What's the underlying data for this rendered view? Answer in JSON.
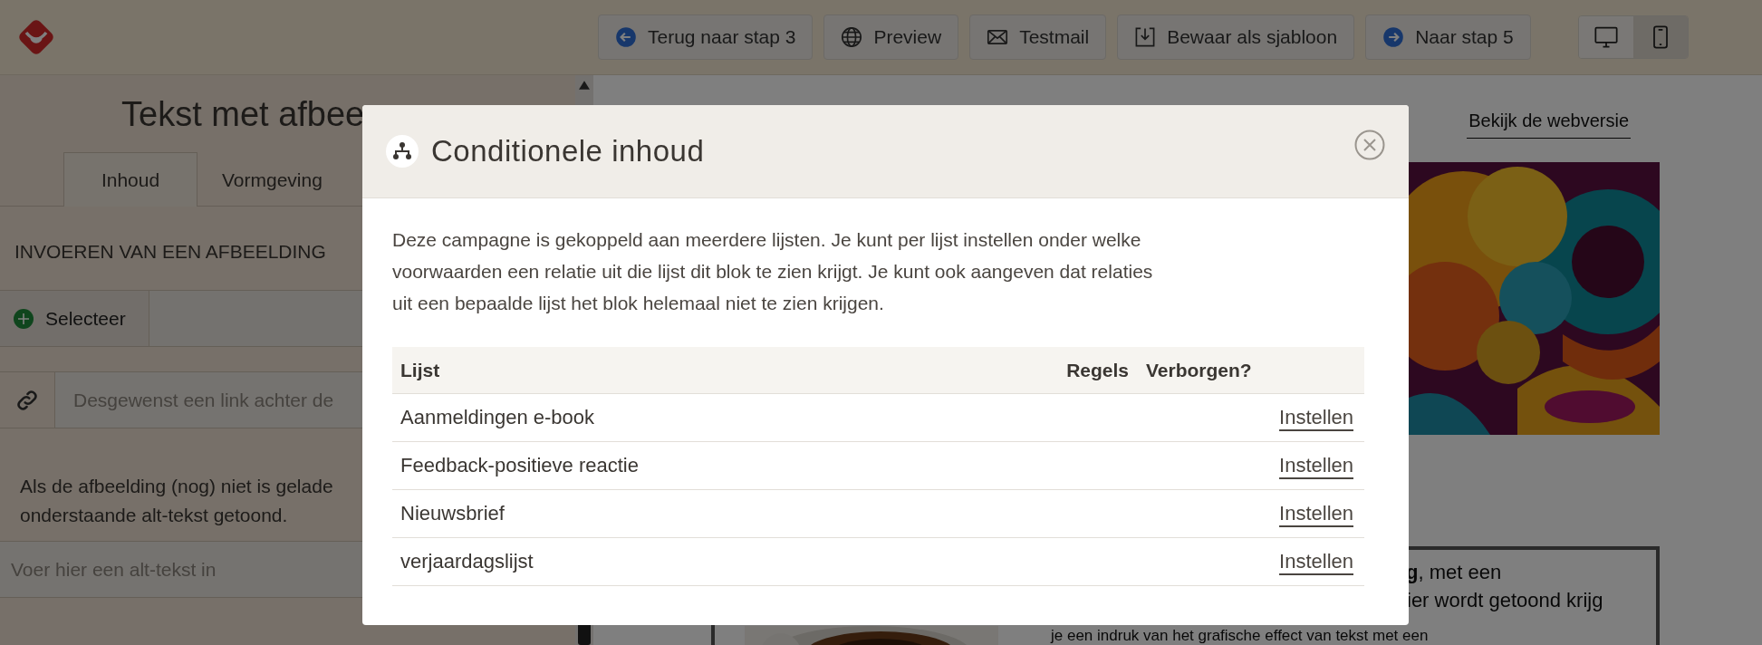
{
  "toolbar": {
    "buttons": [
      {
        "label": "Terug naar stap 3"
      },
      {
        "label": "Preview"
      },
      {
        "label": "Testmail"
      },
      {
        "label": "Bewaar als sjabloon"
      },
      {
        "label": "Naar stap 5"
      }
    ],
    "view_toggle": [
      {
        "selected": true
      },
      {
        "selected": false
      }
    ]
  },
  "editor": {
    "title": "Tekst met afbee",
    "tabs": [
      {
        "label": "Inhoud",
        "selected": true
      },
      {
        "label": "Vormgeving",
        "selected": false
      }
    ],
    "section_label": "INVOEREN VAN EEN AFBEELDING",
    "select_button": "Selecteer",
    "link_field": {
      "placeholder": "Desgewenst een link achter de"
    },
    "info_lines": [
      "Als de afbeelding (nog) niet is gelade",
      "onderstaande alt-tekst getoond."
    ],
    "alt_field": {
      "placeholder": "Voer hier een alt-tekst in"
    }
  },
  "preview": {
    "web_link": "Bekijk de webversie",
    "text_lines": [
      "**g**, met een",
      "ier wordt getoond krijg",
      "je een indruk van het grafische effect van tekst met een"
    ]
  },
  "modal": {
    "title": "Conditionele inhoud",
    "intro": "Deze campagne is gekoppeld aan meerdere lijsten. Je kunt per lijst instellen onder welke voorwaarden een relatie uit die lijst dit blok te zien krijgt. Je kunt ook aangeven dat relaties uit een bepaalde lijst het blok helemaal niet te zien krijgen.",
    "table": {
      "columns": [
        "Lijst",
        "Regels",
        "Verborgen?"
      ],
      "rows": [
        {
          "lijst": "Aanmeldingen e-book",
          "action": "Instellen"
        },
        {
          "lijst": "Feedback-positieve reactie",
          "action": "Instellen"
        },
        {
          "lijst": "Nieuwsbrief",
          "action": "Instellen"
        },
        {
          "lijst": "verjaardagslijst",
          "action": "Instellen"
        }
      ]
    }
  }
}
